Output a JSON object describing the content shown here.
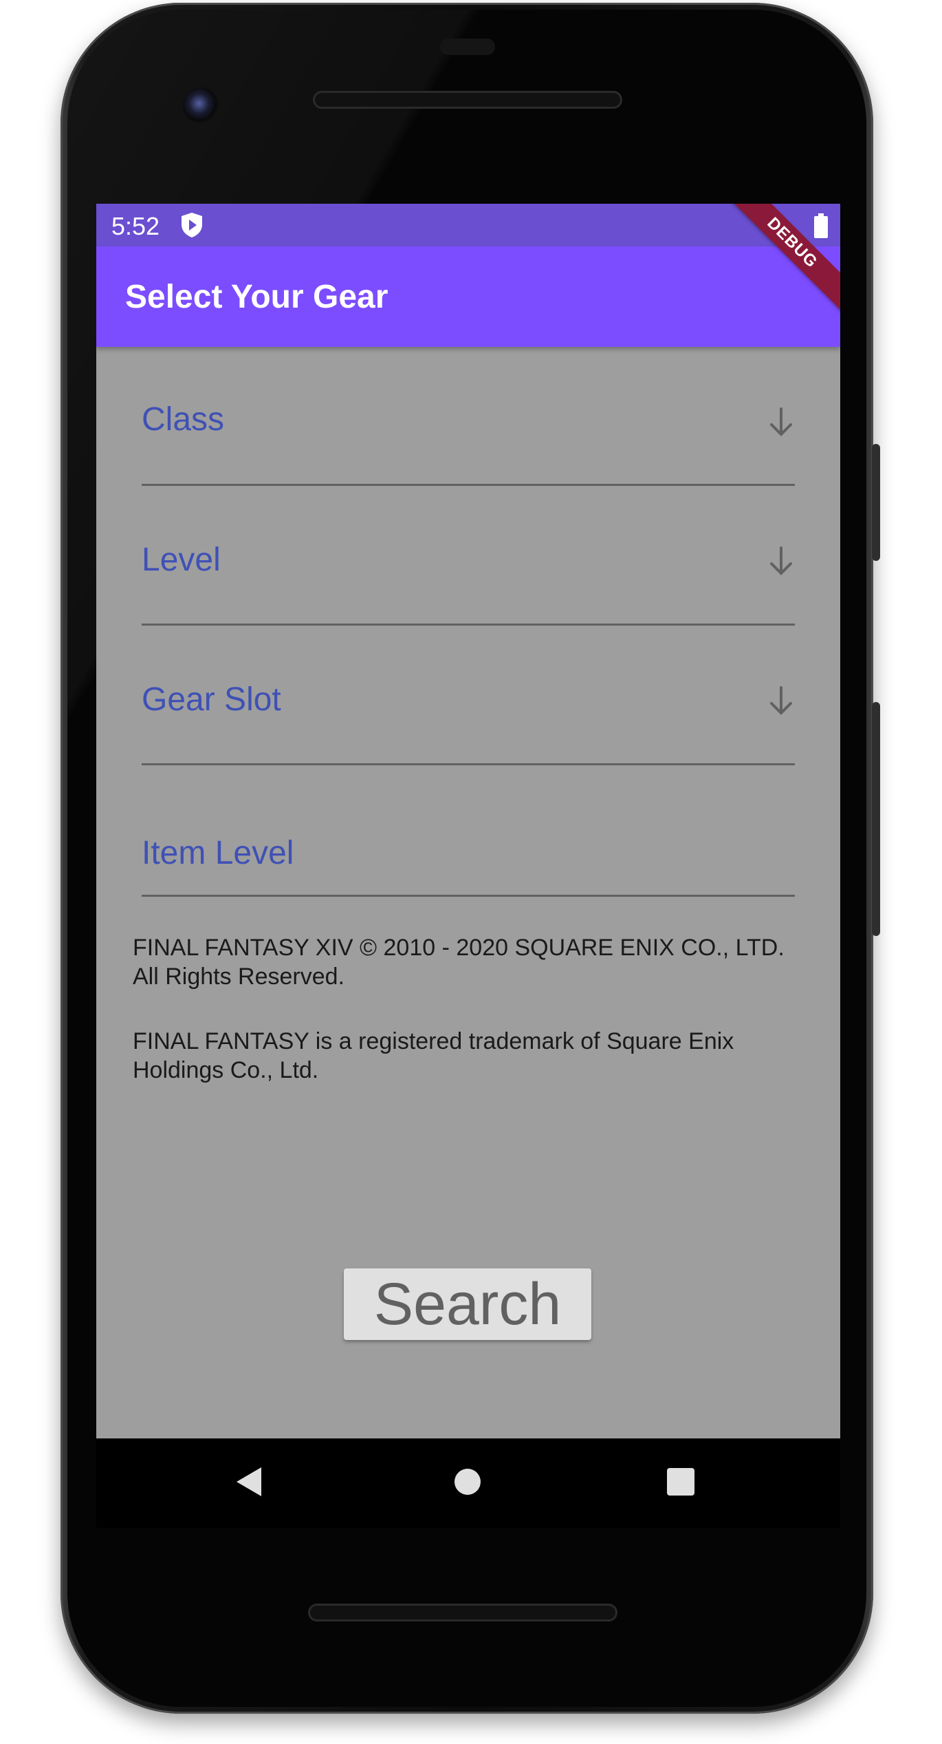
{
  "status_bar": {
    "time": "5:52",
    "icons": [
      "shield-play-icon",
      "battery-icon"
    ]
  },
  "app_bar": {
    "title": "Select Your Gear",
    "debug_banner": "DEBUG"
  },
  "form": {
    "class_label": "Class",
    "level_label": "Level",
    "gear_slot_label": "Gear Slot",
    "item_level_label": "Item Level",
    "dropdown_icon": "arrow-down-icon"
  },
  "legal": {
    "copyright": "FINAL FANTASY XIV © 2010 - 2020 SQUARE ENIX CO., LTD. All Rights Reserved.",
    "trademark": "FINAL FANTASY is a registered trademark of Square Enix Holdings Co., Ltd."
  },
  "search_button": {
    "label": "Search"
  },
  "nav_bar": {
    "icons": [
      "back-icon",
      "home-icon",
      "recents-icon"
    ]
  },
  "colors": {
    "status_bar": "#6a4fd0",
    "app_bar": "#7c4dff",
    "screen_background": "#9e9e9e",
    "field_label": "#3f51b5",
    "debug_banner": "#8b1a3a"
  }
}
